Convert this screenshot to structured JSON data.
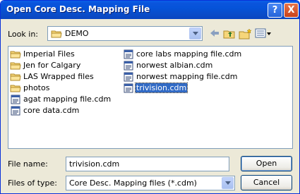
{
  "window": {
    "title": "Open Core Desc. Mapping File"
  },
  "titlebar": {
    "help_label": "?",
    "close_label": "X"
  },
  "lookin": {
    "label": "Look in:",
    "value": "DEMO"
  },
  "files": [
    {
      "name": "Imperial Files",
      "type": "folder",
      "selected": false
    },
    {
      "name": "Jen for Calgary",
      "type": "folder",
      "selected": false
    },
    {
      "name": "LAS Wrapped files",
      "type": "folder",
      "selected": false
    },
    {
      "name": "photos",
      "type": "folder",
      "selected": false
    },
    {
      "name": "agat mapping file.cdm",
      "type": "file",
      "selected": false
    },
    {
      "name": "core data.cdm",
      "type": "file",
      "selected": false
    },
    {
      "name": "core labs mapping file.cdm",
      "type": "file",
      "selected": false
    },
    {
      "name": "norwest albian.cdm",
      "type": "file",
      "selected": false
    },
    {
      "name": "norwest mapping file.cdm",
      "type": "file",
      "selected": false
    },
    {
      "name": "trivision.cdm",
      "type": "file",
      "selected": true
    }
  ],
  "filename": {
    "label": "File name:",
    "value": "trivision.cdm"
  },
  "filetype": {
    "label": "Files of type:",
    "value": "Core Desc. Mapping files (*.cdm)"
  },
  "buttons": {
    "open": "Open",
    "cancel": "Cancel"
  }
}
